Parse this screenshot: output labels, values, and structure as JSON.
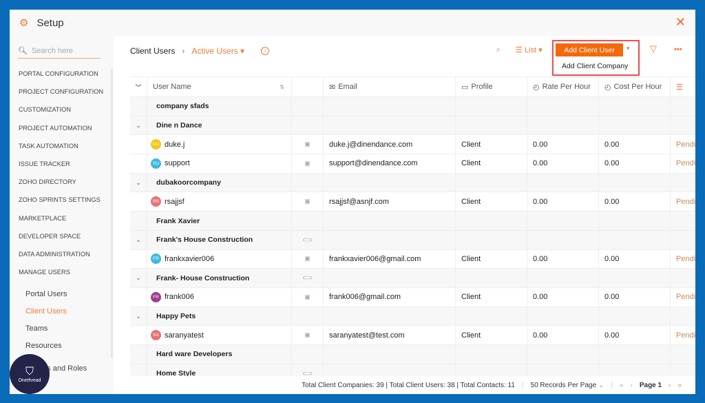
{
  "window": {
    "title": "Setup",
    "icons": {
      "setup": "gear-icon",
      "close": "close-icon"
    }
  },
  "sidebar": {
    "search_placeholder": "Search here",
    "items": [
      "PORTAL CONFIGURATION",
      "PROJECT CONFIGURATION",
      "CUSTOMIZATION",
      "PROJECT AUTOMATION",
      "TASK AUTOMATION",
      "ISSUE TRACKER",
      "ZOHO DIRECTORY",
      "ZOHO SPRINTS SETTINGS",
      "MARKETPLACE",
      "DEVELOPER SPACE",
      "DATA ADMINISTRATION",
      "MANAGE USERS"
    ],
    "subitems": [
      {
        "label": "Portal Users",
        "active": false
      },
      {
        "label": "Client Users",
        "active": true
      },
      {
        "label": "Teams",
        "active": false
      },
      {
        "label": "Resources",
        "active": false
      },
      {
        "label": "Profiles and Roles",
        "active": false
      }
    ]
  },
  "header": {
    "breadcrumb_root": "Client Users",
    "view": "Active Users",
    "list_label": "List",
    "add_button": "Add Client User",
    "dropdown_item": "Add Client Company"
  },
  "table": {
    "columns": [
      "User Name",
      "",
      "Email",
      "Profile",
      "Rate Per Hour",
      "Cost Per Hour",
      ""
    ],
    "rows": [
      {
        "type": "group",
        "name": "company sfads",
        "expand": false,
        "icon": ""
      },
      {
        "type": "group",
        "name": "Dine n Dance",
        "expand": true,
        "icon": ""
      },
      {
        "type": "user",
        "name": "duke.j",
        "initials": "DU",
        "color": "#f5c518",
        "email": "duke.j@dinendance.com",
        "profile": "Client",
        "rate": "0.00",
        "cost": "0.00",
        "status": "Pending"
      },
      {
        "type": "user",
        "name": "support",
        "initials": "SU",
        "color": "#3fb8de",
        "email": "support@dinendance.com",
        "profile": "Client",
        "rate": "0.00",
        "cost": "0.00",
        "status": "Pending"
      },
      {
        "type": "group",
        "name": "dubakoorcompany",
        "expand": true,
        "icon": ""
      },
      {
        "type": "user",
        "name": "rsajjsf",
        "initials": "RS",
        "color": "#e57373",
        "email": "rsajjsf@asnjf.com",
        "profile": "Client",
        "rate": "0.00",
        "cost": "0.00",
        "status": "Pending"
      },
      {
        "type": "group",
        "name": "Frank Xavier",
        "expand": false,
        "icon": ""
      },
      {
        "type": "group",
        "name": "Frank's House Construction",
        "expand": true,
        "icon": "link"
      },
      {
        "type": "user",
        "name": "frankxavier006",
        "initials": "FR",
        "color": "#3fb8de",
        "email": "frankxavier006@gmail.com",
        "profile": "Client",
        "rate": "0.00",
        "cost": "0.00",
        "status": "Pending"
      },
      {
        "type": "group",
        "name": "Frank- House Construction",
        "expand": true,
        "icon": "link"
      },
      {
        "type": "user",
        "name": "frank006",
        "initials": "FR",
        "color": "#9c3d8f",
        "email": "frank006@gmail.com",
        "profile": "Client",
        "rate": "0.00",
        "cost": "0.00",
        "status": "Pending"
      },
      {
        "type": "group",
        "name": "Happy Pets",
        "expand": true,
        "icon": ""
      },
      {
        "type": "user",
        "name": "saranyatest",
        "initials": "SA",
        "color": "#e57373",
        "email": "saranyatest@test.com",
        "profile": "Client",
        "rate": "0.00",
        "cost": "0.00",
        "status": "Pending"
      },
      {
        "type": "group",
        "name": "Hard ware Developers",
        "expand": false,
        "icon": ""
      },
      {
        "type": "group",
        "name": "Home Style",
        "expand": false,
        "icon": "link"
      }
    ]
  },
  "footer": {
    "totals": "Total Client Companies: 39 | Total Client Users: 38 | Total Contacts: 11",
    "records_per_page": "50 Records Per Page",
    "page": "Page 1"
  },
  "watermark": "Onethread",
  "colors": {
    "accent": "#f4690c",
    "highlight_border": "#e0555a",
    "background": "#0a6bb8"
  }
}
